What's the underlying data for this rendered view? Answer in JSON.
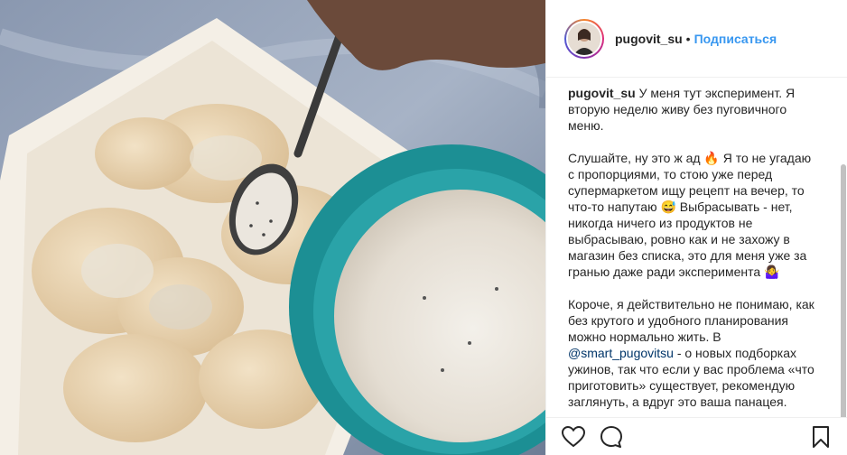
{
  "post": {
    "username": "pugovit_su",
    "separator": "•",
    "follow_label": "Подписаться"
  },
  "caption": {
    "username": "pugovit_su",
    "p1": "У меня тут эксперимент. Я вторую неделю живу без пуговичного меню.",
    "p2_a": "Слушайте, ну это ж ад 🔥 Я то не угадаю с пропорциями, то стою уже перед супермаркетом ищу рецепт на вечер, то что-то напутаю 😅 Выбрасывать - нет, никогда ничего из продуктов не выбрасываю, ровно как и не захожу в магазин без списка, это для меня уже за гранью даже ради эксперимента 🤷‍♀️",
    "p3_a": "Короче, я действительно не понимаю, как без крутого и удобного планирования можно нормально жить. В ",
    "p3_mention": "@smart_pugovitsu",
    "p3_b": " - о новых подборках ужинов, так что если у вас проблема «что приготовить» существует, рекомендую заглянуть, а вдруг это ваша панацея."
  },
  "icons": {
    "like": "heart-icon",
    "comment": "comment-icon",
    "save": "bookmark-icon"
  }
}
